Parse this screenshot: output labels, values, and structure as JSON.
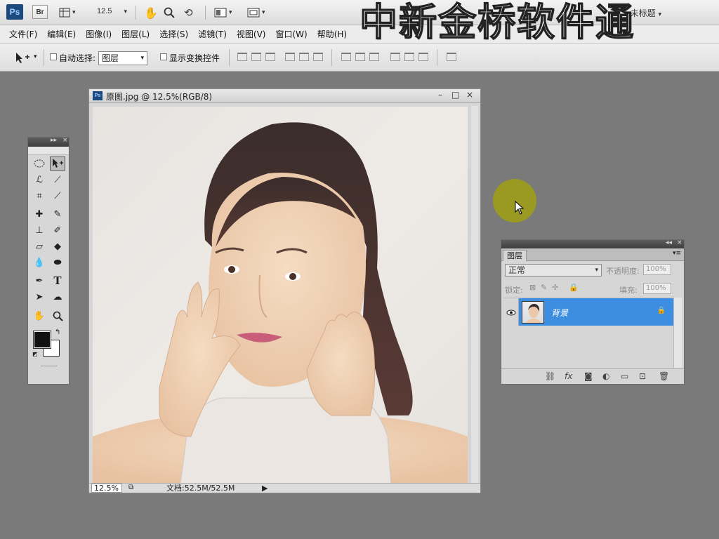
{
  "app": {
    "logo": "Ps",
    "bridge": "Br",
    "zoom": "12.5",
    "workspace": "未标题",
    "zoom_dropdown": "▾",
    "workspace_dropdown": "▾"
  },
  "menu": [
    "文件(F)",
    "编辑(E)",
    "图像(I)",
    "图层(L)",
    "选择(S)",
    "滤镜(T)",
    "视图(V)",
    "窗口(W)",
    "帮助(H)"
  ],
  "options": {
    "auto_select_label": "自动选择:",
    "auto_select_value": "图层",
    "show_transform_label": "显示变换控件"
  },
  "watermark": "中新金桥软件通",
  "document": {
    "title": "原图.jpg @ 12.5%(RGB/8)",
    "zoom": "12.5%",
    "doc_info": "文档:52.5M/52.5M",
    "minimize": "–",
    "maximize": "□",
    "close": "×"
  },
  "tools_panel": {
    "collapse": "▸▸",
    "close": "×"
  },
  "layers_panel": {
    "tab": "图层",
    "blend_mode": "正常",
    "opacity_label": "不透明度:",
    "opacity_value": "100%",
    "lock_label": "锁定:",
    "fill_label": "填充:",
    "fill_value": "100%",
    "layer_name": "背景",
    "collapse": "◂◂",
    "close": "×",
    "menu": "▾≡"
  },
  "colors": {
    "selected_layer": "#3d8ee0",
    "cursor_highlight": "#a0a014"
  }
}
